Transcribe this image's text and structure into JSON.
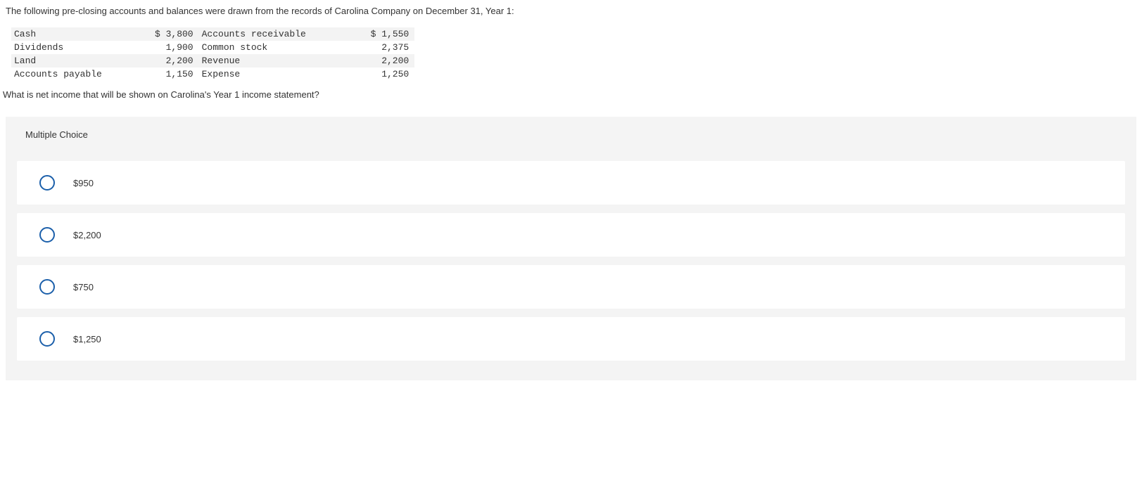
{
  "question": {
    "intro": "The following pre-closing accounts and balances were drawn from the records of Carolina Company on December 31, Year 1:",
    "prompt": "What is net income that will be shown on Carolina's Year 1 income statement?"
  },
  "accounts": [
    {
      "left_label": "Cash",
      "left_value": "$ 3,800",
      "right_label": "Accounts receivable",
      "right_value": "$ 1,550"
    },
    {
      "left_label": "Dividends",
      "left_value": "1,900",
      "right_label": "Common stock",
      "right_value": "2,375"
    },
    {
      "left_label": "Land",
      "left_value": "2,200",
      "right_label": "Revenue",
      "right_value": "2,200"
    },
    {
      "left_label": "Accounts payable",
      "left_value": "1,150",
      "right_label": "Expense",
      "right_value": "1,250"
    }
  ],
  "mc": {
    "header": "Multiple Choice",
    "options": [
      {
        "label": "$950"
      },
      {
        "label": "$2,200"
      },
      {
        "label": "$750"
      },
      {
        "label": "$1,250"
      }
    ]
  }
}
